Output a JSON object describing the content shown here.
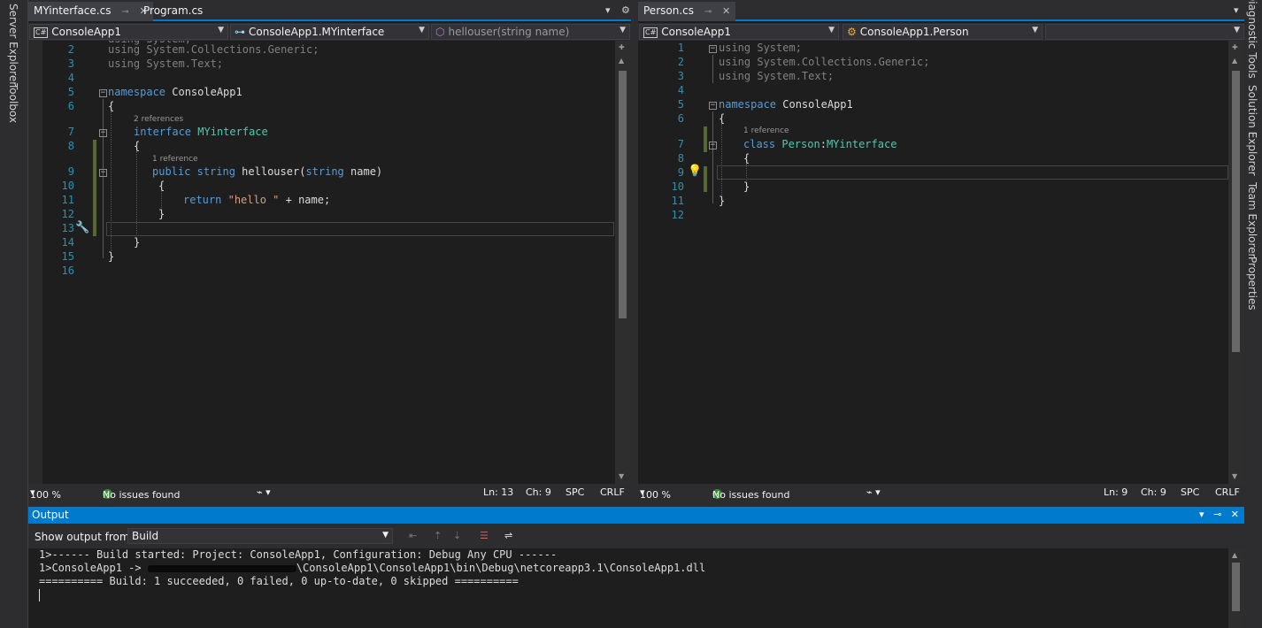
{
  "side_left": [
    "Server Explorer",
    "Toolbox"
  ],
  "side_right": [
    "Diagnostic Tools",
    "Solution Explorer",
    "Team Explorer",
    "Properties"
  ],
  "left_pane": {
    "tabs": [
      "MYinterface.cs",
      "Program.cs"
    ],
    "nav": {
      "project": "ConsoleApp1",
      "type": "ConsoleApp1.MYinterface",
      "member": "hellouser(string name)"
    },
    "references": [
      "2 references",
      "1 reference"
    ],
    "line_numbers": [
      "2",
      "3",
      "4",
      "5",
      "6",
      "7",
      "8",
      "9",
      "10",
      "11",
      "12",
      "13",
      "14",
      "15",
      "16"
    ],
    "status": {
      "zoom": "100 %",
      "issues": "No issues found",
      "line": "Ln: 13",
      "col": "Ch: 9",
      "spc": "SPC",
      "eol": "CRLF"
    }
  },
  "right_pane": {
    "tabs": [
      "Person.cs"
    ],
    "nav": {
      "project": "ConsoleApp1",
      "type": "ConsoleApp1.Person",
      "member": ""
    },
    "references": [
      "1 reference"
    ],
    "line_numbers": [
      "1",
      "2",
      "3",
      "4",
      "5",
      "6",
      "7",
      "8",
      "9",
      "10",
      "11",
      "12"
    ],
    "status": {
      "zoom": "100 %",
      "issues": "No issues found",
      "line": "Ln: 9",
      "col": "Ch: 9",
      "spc": "SPC",
      "eol": "CRLF"
    }
  },
  "output": {
    "title": "Output",
    "show_output_from_label": "Show output from:",
    "source": "Build",
    "lines": [
      "1>------ Build started: Project: ConsoleApp1, Configuration: Debug Any CPU ------",
      "1>ConsoleApp1 -> ",
      "\\ConsoleApp1\\ConsoleApp1\\bin\\Debug\\netcoreapp3.1\\ConsoleApp1.dll",
      "========== Build: 1 succeeded, 0 failed, 0 up-to-date, 0 skipped =========="
    ]
  },
  "colors": {
    "accent": "#007acc",
    "keyword": "#569cd6",
    "type": "#4ec9b0",
    "string": "#d69d85",
    "line_number": "#2b91af",
    "change_marker": "#576932"
  }
}
